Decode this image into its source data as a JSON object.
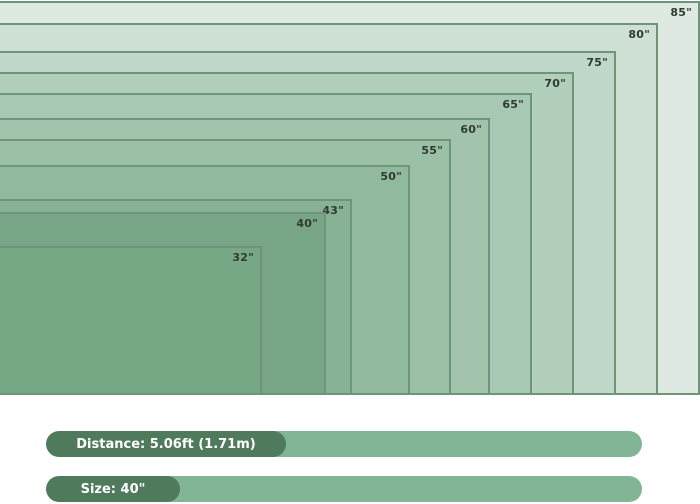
{
  "tv_sizes": [
    {
      "label": "85\"",
      "size": 85,
      "color": "#dde9e1"
    },
    {
      "label": "80\"",
      "size": 80,
      "color": "#cfe0d5"
    },
    {
      "label": "75\"",
      "size": 75,
      "color": "#c0d8c9"
    },
    {
      "label": "70\"",
      "size": 70,
      "color": "#b2cfbc"
    },
    {
      "label": "65\"",
      "size": 65,
      "color": "#a7c8b2"
    },
    {
      "label": "60\"",
      "size": 60,
      "color": "#a2c4ad"
    },
    {
      "label": "55\"",
      "size": 55,
      "color": "#9ac0a6"
    },
    {
      "label": "50\"",
      "size": 50,
      "color": "#91b99e"
    },
    {
      "label": "43\"",
      "size": 43,
      "color": "#88b295"
    },
    {
      "label": "40\"",
      "size": 40,
      "color": "#79a587"
    },
    {
      "label": "32\"",
      "size": 32,
      "color": "#76a885"
    }
  ],
  "distance_bar": {
    "text": "Distance: 5.06ft (1.71m)",
    "fill_fraction": 0.4
  },
  "size_bar": {
    "text": "Size: 40\"",
    "fill_fraction": 0.225
  },
  "colors": {
    "bar_track": "#82b596",
    "bar_fill": "#4f7a5c",
    "outline": "#6e9479"
  }
}
